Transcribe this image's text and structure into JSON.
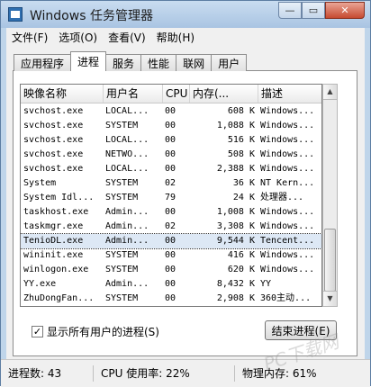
{
  "window": {
    "title": "Windows 任务管理器",
    "min_label": "—",
    "max_label": "▭",
    "close_label": "✕"
  },
  "menu": [
    "文件(F)",
    "选项(O)",
    "查看(V)",
    "帮助(H)"
  ],
  "tabs": [
    "应用程序",
    "进程",
    "服务",
    "性能",
    "联网",
    "用户"
  ],
  "active_tab": "进程",
  "columns": [
    "映像名称",
    "用户名",
    "CPU",
    "内存(...",
    "描述"
  ],
  "rows": [
    {
      "name": "svchost.exe",
      "user": "LOCAL...",
      "cpu": "00",
      "mem": "608 K",
      "desc": "Windows..."
    },
    {
      "name": "svchost.exe",
      "user": "SYSTEM",
      "cpu": "00",
      "mem": "1,088 K",
      "desc": "Windows..."
    },
    {
      "name": "svchost.exe",
      "user": "LOCAL...",
      "cpu": "00",
      "mem": "516 K",
      "desc": "Windows..."
    },
    {
      "name": "svchost.exe",
      "user": "NETWO...",
      "cpu": "00",
      "mem": "508 K",
      "desc": "Windows..."
    },
    {
      "name": "svchost.exe",
      "user": "LOCAL...",
      "cpu": "00",
      "mem": "2,388 K",
      "desc": "Windows..."
    },
    {
      "name": "System",
      "user": "SYSTEM",
      "cpu": "02",
      "mem": "36 K",
      "desc": "NT Kern..."
    },
    {
      "name": "System Idl...",
      "user": "SYSTEM",
      "cpu": "79",
      "mem": "24 K",
      "desc": "处理器..."
    },
    {
      "name": "taskhost.exe",
      "user": "Admin...",
      "cpu": "00",
      "mem": "1,008 K",
      "desc": "Windows..."
    },
    {
      "name": "taskmgr.exe",
      "user": "Admin...",
      "cpu": "02",
      "mem": "3,308 K",
      "desc": "Windows..."
    },
    {
      "name": "TenioDL.exe",
      "user": "Admin...",
      "cpu": "00",
      "mem": "9,544 K",
      "desc": "Tencent..."
    },
    {
      "name": "wininit.exe",
      "user": "SYSTEM",
      "cpu": "00",
      "mem": "416 K",
      "desc": "Windows..."
    },
    {
      "name": "winlogon.exe",
      "user": "SYSTEM",
      "cpu": "00",
      "mem": "620 K",
      "desc": "Windows..."
    },
    {
      "name": "YY.exe",
      "user": "Admin...",
      "cpu": "00",
      "mem": "8,432 K",
      "desc": "YY"
    },
    {
      "name": "ZhuDongFan...",
      "user": "SYSTEM",
      "cpu": "00",
      "mem": "2,908 K",
      "desc": "360主动..."
    }
  ],
  "selected_row": 9,
  "show_all_users": {
    "label": "显示所有用户的进程(S)",
    "checked": true,
    "mark": "✓"
  },
  "end_process_label": "结束进程(E)",
  "status": {
    "processes": "进程数: 43",
    "cpu": "CPU 使用率: 22%",
    "memory": "物理内存: 61%"
  },
  "watermark": "PC下载网"
}
